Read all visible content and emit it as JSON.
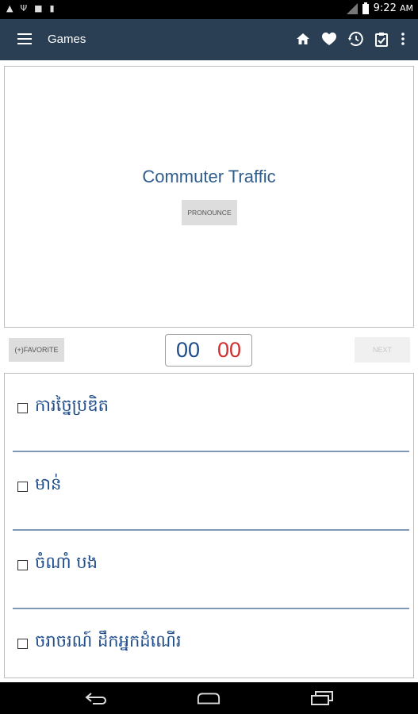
{
  "status_bar": {
    "time": "9:22",
    "ampm": "AM"
  },
  "app_bar": {
    "title": "Games",
    "actions": [
      "home-icon",
      "heart-icon",
      "history-icon",
      "clipboard-icon",
      "more-vert-icon"
    ]
  },
  "card": {
    "word": "Commuter Traffic",
    "pronounce_label": "PRONOUNCE"
  },
  "controls": {
    "favorite_label": "(+)FAVORITE",
    "timer_minutes": "00",
    "timer_seconds": "00",
    "next_label": "NEXT"
  },
  "options": [
    {
      "label": "ការច្នៃប្រឌិត",
      "checked": false
    },
    {
      "label": "មាន់",
      "checked": false
    },
    {
      "label": "ចំណាំ បង",
      "checked": false
    },
    {
      "label": "ចរាចរណ៍ ដឹកអ្នកដំណើរ",
      "checked": false
    }
  ],
  "colors": {
    "app_bar": "#2b3f54",
    "word": "#2f5d8c",
    "timer_minutes": "#1f4d8a",
    "timer_seconds": "#d32f2f",
    "divider": "#8098b8"
  }
}
